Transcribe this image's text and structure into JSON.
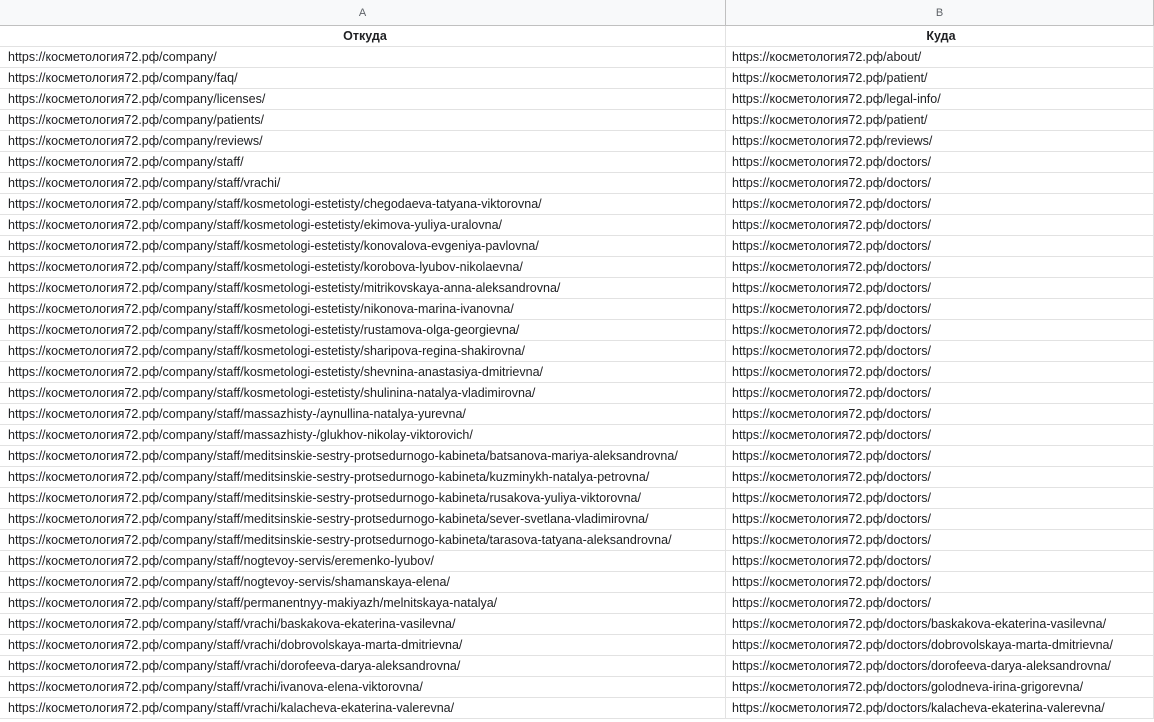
{
  "columns": [
    "A",
    "B"
  ],
  "header": {
    "from": "Откуда",
    "to": "Куда"
  },
  "rows": [
    {
      "from": "https://косметология72.рф/company/",
      "to": "https://косметология72.рф/about/"
    },
    {
      "from": "https://косметология72.рф/company/faq/",
      "to": "https://косметология72.рф/patient/"
    },
    {
      "from": "https://косметология72.рф/company/licenses/",
      "to": "https://косметология72.рф/legal-info/"
    },
    {
      "from": "https://косметология72.рф/company/patients/",
      "to": "https://косметология72.рф/patient/"
    },
    {
      "from": "https://косметология72.рф/company/reviews/",
      "to": "https://косметология72.рф/reviews/"
    },
    {
      "from": "https://косметология72.рф/company/staff/",
      "to": "https://косметология72.рф/doctors/"
    },
    {
      "from": "https://косметология72.рф/company/staff/vrachi/",
      "to": "https://косметология72.рф/doctors/"
    },
    {
      "from": "https://косметология72.рф/company/staff/kosmetologi-estetisty/chegodaeva-tatyana-viktorovna/",
      "to": "https://косметология72.рф/doctors/"
    },
    {
      "from": "https://косметология72.рф/company/staff/kosmetologi-estetisty/ekimova-yuliya-uralovna/",
      "to": "https://косметология72.рф/doctors/"
    },
    {
      "from": "https://косметология72.рф/company/staff/kosmetologi-estetisty/konovalova-evgeniya-pavlovna/",
      "to": "https://косметология72.рф/doctors/"
    },
    {
      "from": "https://косметология72.рф/company/staff/kosmetologi-estetisty/korobova-lyubov-nikolaevna/",
      "to": "https://косметология72.рф/doctors/"
    },
    {
      "from": "https://косметология72.рф/company/staff/kosmetologi-estetisty/mitrikovskaya-anna-aleksandrovna/",
      "to": "https://косметология72.рф/doctors/"
    },
    {
      "from": "https://косметология72.рф/company/staff/kosmetologi-estetisty/nikonova-marina-ivanovna/",
      "to": "https://косметология72.рф/doctors/"
    },
    {
      "from": "https://косметология72.рф/company/staff/kosmetologi-estetisty/rustamova-olga-georgievna/",
      "to": "https://косметология72.рф/doctors/"
    },
    {
      "from": "https://косметология72.рф/company/staff/kosmetologi-estetisty/sharipova-regina-shakirovna/",
      "to": "https://косметология72.рф/doctors/"
    },
    {
      "from": "https://косметология72.рф/company/staff/kosmetologi-estetisty/shevnina-anastasiya-dmitrievna/",
      "to": "https://косметология72.рф/doctors/"
    },
    {
      "from": "https://косметология72.рф/company/staff/kosmetologi-estetisty/shulinina-natalya-vladimirovna/",
      "to": "https://косметология72.рф/doctors/"
    },
    {
      "from": "https://косметология72.рф/company/staff/massazhisty-/aynullina-natalya-yurevna/",
      "to": "https://косметология72.рф/doctors/"
    },
    {
      "from": "https://косметология72.рф/company/staff/massazhisty-/glukhov-nikolay-viktorovich/",
      "to": "https://косметология72.рф/doctors/"
    },
    {
      "from": "https://косметология72.рф/company/staff/meditsinskie-sestry-protsedurnogo-kabineta/batsanova-mariya-aleksandrovna/",
      "to": "https://косметология72.рф/doctors/"
    },
    {
      "from": "https://косметология72.рф/company/staff/meditsinskie-sestry-protsedurnogo-kabineta/kuzminykh-natalya-petrovna/",
      "to": "https://косметология72.рф/doctors/"
    },
    {
      "from": "https://косметология72.рф/company/staff/meditsinskie-sestry-protsedurnogo-kabineta/rusakova-yuliya-viktorovna/",
      "to": "https://косметология72.рф/doctors/"
    },
    {
      "from": "https://косметология72.рф/company/staff/meditsinskie-sestry-protsedurnogo-kabineta/sever-svetlana-vladimirovna/",
      "to": "https://косметология72.рф/doctors/"
    },
    {
      "from": "https://косметология72.рф/company/staff/meditsinskie-sestry-protsedurnogo-kabineta/tarasova-tatyana-aleksandrovna/",
      "to": "https://косметология72.рф/doctors/"
    },
    {
      "from": "https://косметология72.рф/company/staff/nogtevoy-servis/eremenko-lyubov/",
      "to": "https://косметология72.рф/doctors/"
    },
    {
      "from": "https://косметология72.рф/company/staff/nogtevoy-servis/shamanskaya-elena/",
      "to": "https://косметология72.рф/doctors/"
    },
    {
      "from": "https://косметология72.рф/company/staff/permanentnyy-makiyazh/melnitskaya-natalya/",
      "to": "https://косметология72.рф/doctors/"
    },
    {
      "from": "https://косметология72.рф/company/staff/vrachi/baskakova-ekaterina-vasilevna/",
      "to": "https://косметология72.рф/doctors/baskakova-ekaterina-vasilevna/"
    },
    {
      "from": "https://косметология72.рф/company/staff/vrachi/dobrovolskaya-marta-dmitrievna/",
      "to": "https://косметология72.рф/doctors/dobrovolskaya-marta-dmitrievna/"
    },
    {
      "from": "https://косметология72.рф/company/staff/vrachi/dorofeeva-darya-aleksandrovna/",
      "to": "https://косметология72.рф/doctors/dorofeeva-darya-aleksandrovna/"
    },
    {
      "from": "https://косметология72.рф/company/staff/vrachi/ivanova-elena-viktorovna/",
      "to": "https://косметология72.рф/doctors/golodneva-irina-grigorevna/"
    },
    {
      "from": "https://косметология72.рф/company/staff/vrachi/kalacheva-ekaterina-valerevna/",
      "to": "https://косметология72.рф/doctors/kalacheva-ekaterina-valerevna/"
    }
  ]
}
